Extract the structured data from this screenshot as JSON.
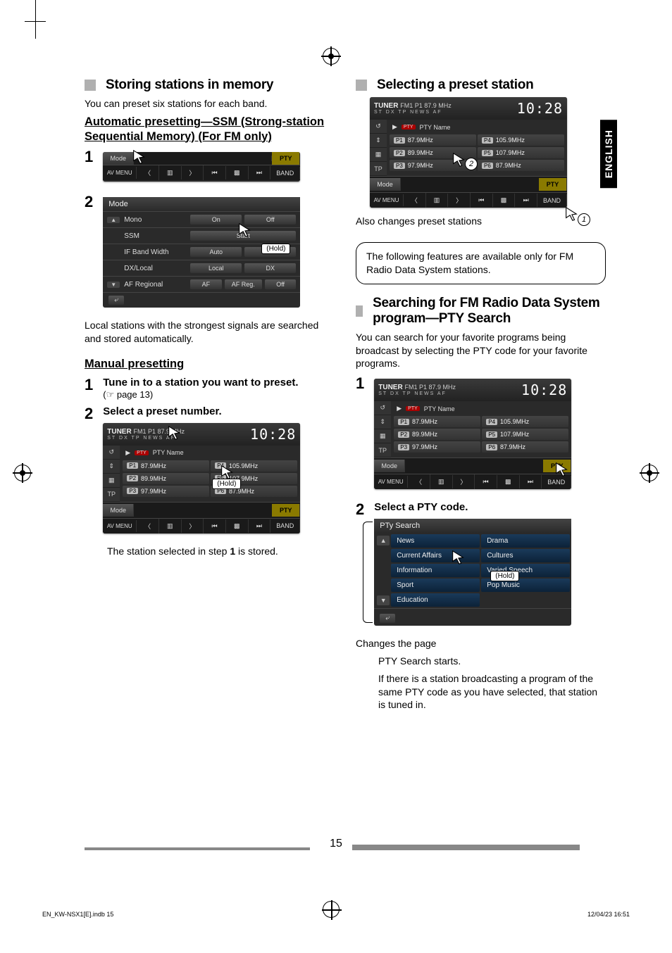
{
  "language_tab": "ENGLISH",
  "page_number": "15",
  "footer": {
    "file": "EN_KW-NSX1[E].indb   15",
    "date": "12/04/23   16:51"
  },
  "left": {
    "title_storing": "Storing stations in memory",
    "intro_storing": "You can preset six stations for each band.",
    "auto_heading": "Automatic presetting—SSM (Strong-station Sequential Memory) (For FM only)",
    "auto_outro": "Local stations with the strongest signals are searched and stored automatically.",
    "manual_heading": "Manual presetting",
    "manual_step1": "Tune in to a station you want to preset.",
    "manual_page_ref": "(☞ page 13)",
    "manual_step2": "Select a preset number.",
    "stored_note_pre": "The station selected in step ",
    "stored_note_bold": "1",
    "stored_note_post": " is stored."
  },
  "right": {
    "title_select": "Selecting a preset station",
    "also_changes": "Also changes preset stations",
    "fm_note": "The following features are available only for FM Radio Data System stations.",
    "title_pty": "Searching for FM Radio Data System program—PTY Search",
    "intro_pty": "You can search for your favorite programs being broadcast by selecting the PTY code for your favorite programs.",
    "step2_pty": "Select a PTY code.",
    "changes_page": "Changes the page",
    "pty_starts": "PTY Search starts.",
    "pty_result": "If there is a station broadcasting a program of the same PTY code as you have selected, that station is tuned in."
  },
  "ui": {
    "tuner_label": "TUNER",
    "band_sub": "FM1 P1 87.9 MHz",
    "clock": "10:28",
    "indicators": "ST   DX   TP   NEWS   AF",
    "pty_name": "PTY Name",
    "mode_btn": "Mode",
    "avmenu_btn": "AV MENU",
    "pty_btn": "PTY",
    "band_btn": "BAND",
    "hold_label": "(Hold)",
    "presets": [
      {
        "n": "P1",
        "f": "87.9MHz"
      },
      {
        "n": "P2",
        "f": "89.9MHz"
      },
      {
        "n": "P3",
        "f": "97.9MHz"
      },
      {
        "n": "P4",
        "f": "105.9MHz"
      },
      {
        "n": "P5",
        "f": "107.9MHz"
      },
      {
        "n": "P6",
        "f": "87.9MHz"
      }
    ]
  },
  "mode_panel": {
    "title": "Mode",
    "rows": {
      "mono": {
        "label": "Mono",
        "on": "On",
        "off": "Off"
      },
      "ssm": {
        "label": "SSM",
        "start": "Start"
      },
      "ifbw": {
        "label": "IF Band Width",
        "auto": "Auto",
        "wide": "Wide"
      },
      "dxlocal": {
        "label": "DX/Local",
        "local": "Local",
        "dx": "DX"
      },
      "afreg": {
        "label": "AF Regional",
        "af": "AF",
        "afreg": "AF Reg.",
        "off": "Off"
      }
    },
    "back": "⤶"
  },
  "pty_panel": {
    "title": "PTy Search",
    "items": [
      "News",
      "Drama",
      "Current Affairs",
      "Cultures",
      "Information",
      "Varied Speech",
      "Sport",
      "Pop Music",
      "Education",
      ""
    ],
    "items_col1": [
      "News",
      "Current Affairs",
      "Information",
      "Sport",
      "Education"
    ],
    "items_col2": [
      "Drama",
      "Cultures",
      "Varied Speech",
      "Pop Music"
    ]
  },
  "callouts": {
    "c1": "1",
    "c2": "2",
    "hold": "(Hold)"
  }
}
